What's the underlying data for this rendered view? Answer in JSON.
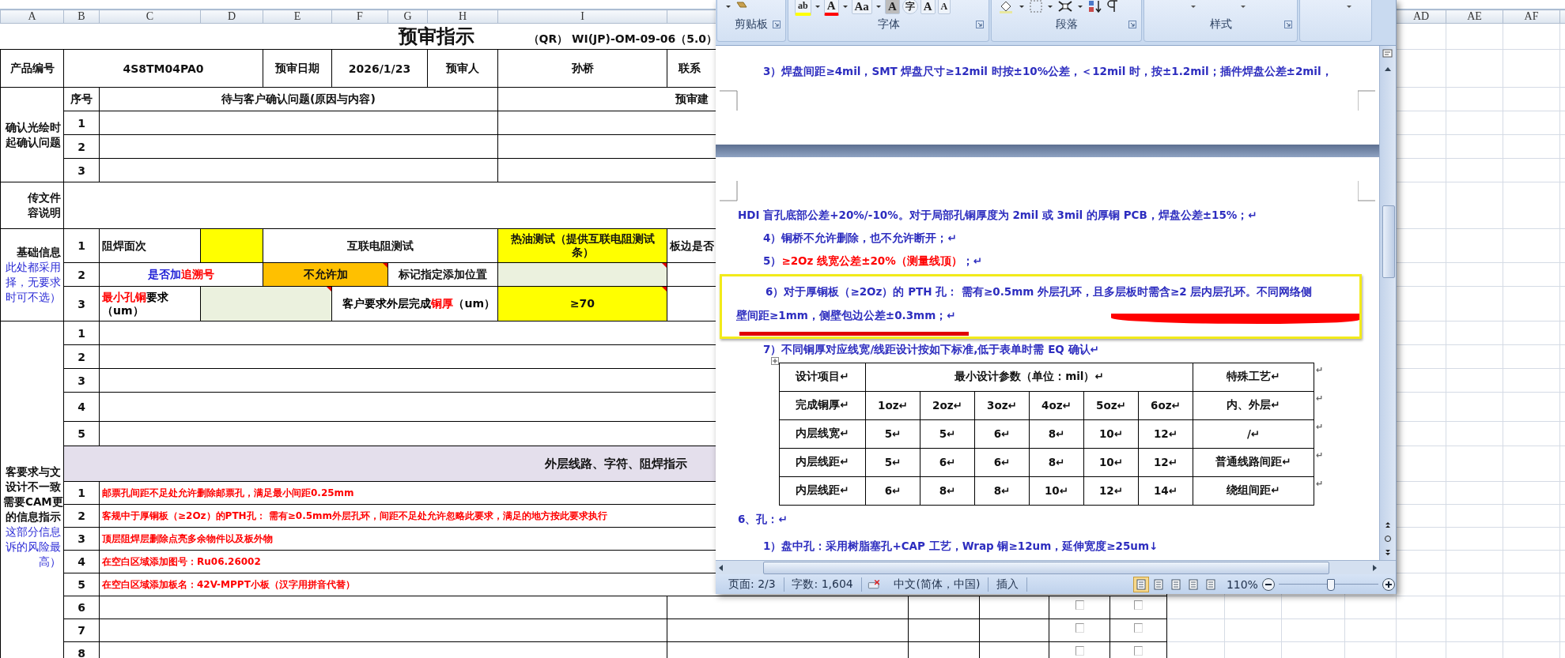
{
  "column_headers": [
    "A",
    "B",
    "C",
    "D",
    "E",
    "F",
    "G",
    "H",
    "I",
    "AD",
    "AE",
    "AF"
  ],
  "sheet": {
    "title": "预审指示",
    "form_code": "（QR） WI(JP)-OM-09-06（5.0）",
    "product": {
      "label": "产品编号",
      "part_no": "4S8TM04PA0",
      "date_label": "预审日期",
      "date": "2026/1/23",
      "reviewer_label": "预审人",
      "reviewer": "孙桥",
      "contact_label": "联系"
    },
    "confirm": {
      "label_lines": [
        "确认光绘时",
        "起确认问题"
      ],
      "no_header": "序号",
      "issue_header": "待与客户确认问题(原因与内容)",
      "advice_header": "预审建",
      "rows": [
        {
          "no": "1"
        },
        {
          "no": "2"
        },
        {
          "no": "3"
        }
      ]
    },
    "files": {
      "label_lines": [
        "传文件",
        "容说明"
      ]
    },
    "basic": {
      "label": "基础信息",
      "note_lines": [
        "此处都采用",
        "择，无要求",
        "时可不选）"
      ],
      "rows": [
        {
          "no": "1",
          "cells": [
            {
              "text": "阻焊面次",
              "comment": false
            },
            {
              "color": "#ffff00",
              "comment": false
            },
            {
              "text": "互联电阻测试",
              "colspan": 4,
              "comment": false
            },
            {
              "text": "热油测试（提供互联电阻测试条）",
              "color": "#ffff00",
              "comment": false
            },
            {
              "text": "板边是否",
              "colspan": 5
            }
          ]
        },
        {
          "no": "2",
          "cells": [
            {
              "parts": [
                {
                  "text": "是否加",
                  "color": "#1f1fd6"
                },
                {
                  "text": "追溯号",
                  "color": "#ff0000"
                }
              ],
              "colspan": 2,
              "comment": false
            },
            {
              "text": "不允许加",
              "color": "#ffc000",
              "colspan": 2,
              "comment": true
            },
            {
              "text": "标记指定添加位置",
              "colspan": 2,
              "comment": false
            },
            {
              "color": "#ebf1de",
              "comment": true
            },
            {
              "colspan": 5
            }
          ]
        },
        {
          "no": "3",
          "cells": [
            {
              "parts": [
                {
                  "text": "最小孔铜",
                  "color": "#ff0000"
                },
                {
                  "text": "要求",
                  "color": "#000000"
                },
                {
                  "text": "（um）",
                  "color": "#000000",
                  "new_line": true
                }
              ],
              "comment": false
            },
            {
              "color": "#ebf1de",
              "colspan": 2,
              "comment": true
            },
            {
              "parts": [
                {
                  "text": "客户要求外层完成",
                  "color": "#000000"
                },
                {
                  "text": "铜厚",
                  "color": "#ff0000"
                },
                {
                  "text": "（um）",
                  "color": "#000000"
                }
              ],
              "colspan": 3,
              "comment": false
            },
            {
              "text": "≥70",
              "color": "#ffff00",
              "comment": true
            },
            {
              "colspan": 5
            }
          ]
        }
      ]
    },
    "issues": {
      "label_lines": [
        "客要求与文",
        "设计不一致",
        "需要CAM更",
        "的信息指示"
      ],
      "note_lines": [
        "这部分信息",
        "诉的风险最",
        "高）"
      ],
      "rows": [
        {
          "no": "1"
        },
        {
          "no": "2"
        },
        {
          "no": "3"
        },
        {
          "no": "4"
        },
        {
          "no": "5"
        }
      ]
    },
    "instructions": {
      "header": "外层线路、字符、阻焊指示",
      "rows": [
        {
          "kind": "instruction",
          "no": "1",
          "text": "邮票孔间距不足处允许删除邮票孔，满足最小间距0.25mm"
        },
        {
          "kind": "instruction",
          "no": "2",
          "text": "客规中于厚铜板（≥2Oz）的PTH孔： 需有≥0.5mm外层孔环，间距不足处允许忽略此要求，满足的地方按此要求执行"
        },
        {
          "kind": "instruction",
          "no": "3",
          "text": "顶层阻焊层删除点亮多余物件以及板外物"
        },
        {
          "kind": "instruction",
          "no": "4",
          "text": "在空白区域添加图号：Ru06.26002"
        },
        {
          "kind": "instruction",
          "no": "5",
          "text": "在空白区域添加板名：42V-MPPT小板（汉字用拼音代替）"
        },
        {
          "kind": "checklist",
          "no": "6",
          "checks": [
            {
              "checked": false
            },
            {
              "checked": false
            }
          ]
        },
        {
          "kind": "checklist",
          "no": "7",
          "checks": [
            {
              "checked": false
            },
            {
              "checked": false
            }
          ]
        },
        {
          "kind": "checklist",
          "no": "8",
          "checks": [
            {
              "checked": false
            },
            {
              "checked": false
            }
          ]
        }
      ]
    }
  },
  "word": {
    "ribbon": {
      "groups": [
        {
          "label": "剪贴板",
          "launcher": true
        },
        {
          "label": "字体",
          "launcher": true,
          "buttons": [
            {
              "kind": "highlight",
              "label": "ab"
            },
            {
              "kind": "font-color",
              "label": "A"
            },
            {
              "kind": "case",
              "label": "Aa"
            },
            {
              "kind": "shading",
              "label": "A"
            },
            {
              "kind": "enclose",
              "label": "字"
            },
            {
              "kind": "grow",
              "label": "A"
            },
            {
              "kind": "shrink",
              "label": "A"
            }
          ]
        },
        {
          "label": "段落",
          "launcher": true
        },
        {
          "label": "样式",
          "launcher": true
        },
        {
          "launcher": false
        }
      ]
    },
    "page_one": {
      "lines": [
        "3）焊盘间距≥4mil，SMT 焊盘尺寸≥12mil 时按±10%公差，＜12mil 时，按±1.2mil；插件焊盘公差±2mil，"
      ]
    },
    "page_two": {
      "paragraphs": [
        {
          "kind": "continued",
          "parts": [
            {
              "text": "HDI 盲孔底部公差+20%/-10%。对于局部孔铜厚度为 2mil 或 3mil 的厚铜 PCB，焊盘公差±15%；↵",
              "color": "#2d2dbf"
            }
          ]
        },
        {
          "kind": "item",
          "parts": [
            {
              "text": "4）铜桥不允许删除，也不允许断开；↵",
              "color": "#2d2dbf"
            }
          ]
        },
        {
          "kind": "item",
          "parts": [
            {
              "text": "5）",
              "color": "#2d2dbf"
            },
            {
              "text": "≥2Oz 线宽公差±20%（测量线顶）",
              "color": "#ff0000"
            },
            {
              "text": "；↵",
              "color": "#2d2dbf"
            }
          ]
        }
      ],
      "highlight_box": {
        "lines": [
          "6）对于厚铜板（≥2Oz）的 PTH 孔： 需有≥0.5mm 外层孔环，且多层板时需含≥2 层内层孔环。不同网络侧",
          "壁间距≥1mm，侧壁包边公差±0.3mm；↵"
        ]
      },
      "after": [
        {
          "kind": "item",
          "parts": [
            {
              "text": "7）不同铜厚对应线宽/线距设计按如下标准,低于表单时需 EQ 确认↵",
              "color": "#2d2dbf"
            }
          ]
        }
      ],
      "table": {
        "header": {
          "cells": [
            "设计项目↵",
            "最小设计参数（单位：mil）↵",
            "特殊工艺↵"
          ],
          "end_mark": "↵"
        },
        "rows": [
          {
            "cells": [
              "完成铜厚↵",
              "1oz↵",
              "2oz↵",
              "3oz↵",
              "4oz↵",
              "5oz↵",
              "6oz↵",
              "内、外层↵"
            ],
            "end_mark": "↵"
          },
          {
            "cells": [
              "内层线宽↵",
              "5↵",
              "5↵",
              "6↵",
              "8↵",
              "10↵",
              "12↵",
              "/↵"
            ],
            "end_mark": "↵"
          },
          {
            "cells": [
              "内层线距↵",
              "5↵",
              "6↵",
              "6↵",
              "8↵",
              "10↵",
              "12↵",
              "普通线路间距↵"
            ],
            "end_mark": "↵"
          },
          {
            "cells": [
              "内层线距↵",
              "6↵",
              "8↵",
              "8↵",
              "10↵",
              "12↵",
              "14↵",
              "绕组间距↵"
            ],
            "end_mark": "↵"
          }
        ]
      },
      "tail": [
        {
          "kind": "continued",
          "parts": [
            {
              "text": "6、孔：↵",
              "color": "#2d2dbf"
            }
          ]
        },
        {
          "kind": "item",
          "parts": [
            {
              "text": "1）盘中孔：采用树脂塞孔+CAP 工艺，Wrap 铜≥12um，延伸宽度≥25um↓",
              "color": "#2d2dbf"
            }
          ]
        }
      ]
    },
    "status_bar": {
      "page": "页面: 2/3",
      "words": "字数: 1,604",
      "language": "中文(简体，中国)",
      "mode": "插入",
      "views": [
        {
          "selected": true
        },
        {
          "selected": false
        },
        {
          "selected": false
        },
        {
          "selected": false
        },
        {
          "selected": false
        }
      ],
      "zoom": "110%",
      "level": 0.52
    }
  }
}
